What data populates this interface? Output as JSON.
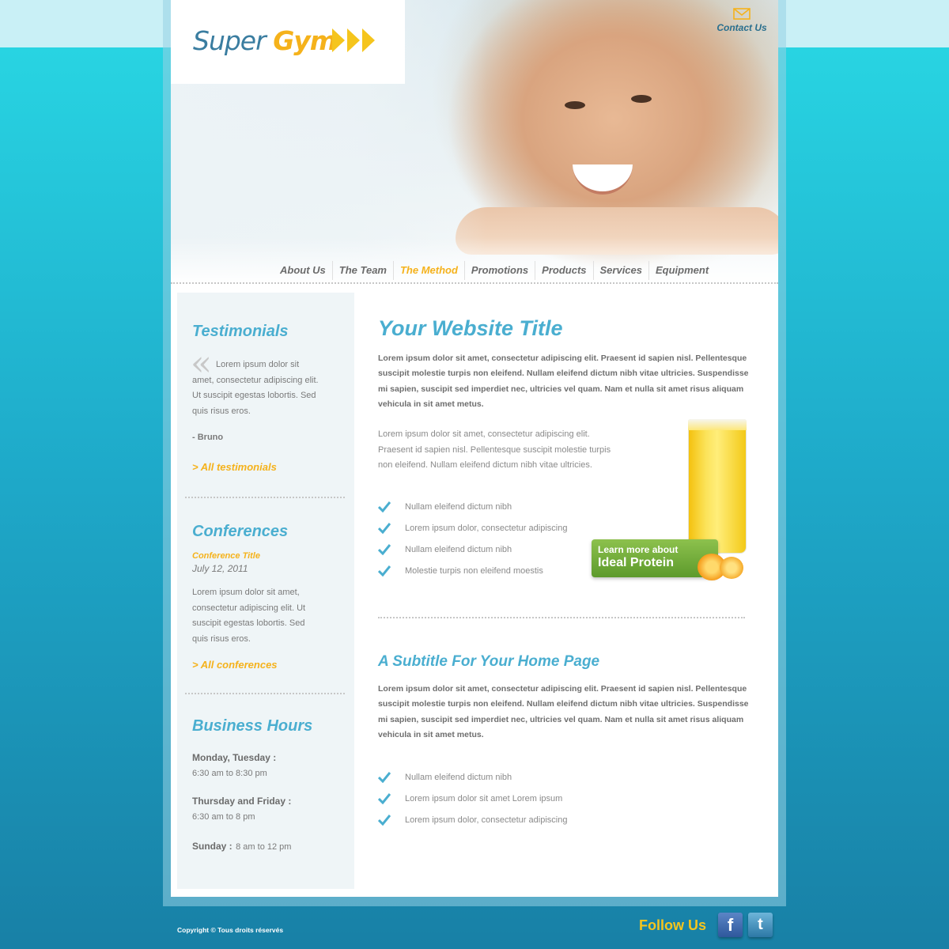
{
  "brand": {
    "word1": "Super",
    "word2": "Gym"
  },
  "header": {
    "contact_label": "Contact Us"
  },
  "nav": {
    "items": [
      "About Us",
      "The Team",
      "The Method",
      "Promotions",
      "Products",
      "Services",
      "Equipment"
    ],
    "active_index": 2
  },
  "sidebar": {
    "testimonials": {
      "title": "Testimonials",
      "quote": "Lorem ipsum dolor sit amet, consectetur adipiscing elit. Ut suscipit egestas lobortis. Sed quis risus eros.",
      "author": "- Bruno",
      "link": "> All testimonials"
    },
    "conferences": {
      "title": "Conferences",
      "item_title": "Conference Title",
      "item_date": "July 12, 2011",
      "text": "Lorem ipsum dolor sit amet, consectetur adipiscing elit. Ut suscipit egestas lobortis. Sed quis risus eros.",
      "link": "> All conferences"
    },
    "hours": {
      "title": "Business Hours",
      "rows": [
        {
          "day": "Monday, Tuesday :",
          "time": "6:30 am to 8:30 pm"
        },
        {
          "day": "Thursday and Friday :",
          "time": "6:30 am to 8 pm"
        },
        {
          "day": "Sunday :",
          "time": "8 am to 12 pm"
        }
      ]
    }
  },
  "main": {
    "title": "Your Website Title",
    "intro": "Lorem ipsum dolor sit amet, consectetur adipiscing elit. Praesent id sapien nisl. Pellentesque suscipit molestie turpis non eleifend. Nullam eleifend dictum nibh vitae ultricies. Suspendisse mi sapien, suscipit sed imperdiet nec, ultricies vel quam. Nam et nulla sit amet risus aliquam vehicula in sit amet metus.",
    "para": "Lorem ipsum dolor sit amet, consectetur adipiscing elit. Praesent id sapien nisl. Pellentesque suscipit molestie turpis non eleifend. Nullam eleifend dictum nibh vitae ultricies.",
    "checklist1": [
      "Nullam eleifend dictum nibh",
      "Lorem ipsum dolor, consectetur adipiscing",
      "Nullam eleifend dictum nibh",
      "Molestie turpis non eleifend moestis"
    ],
    "promo": {
      "line1": "Learn more about",
      "line2": "Ideal Protein"
    },
    "subtitle": "A Subtitle For Your Home Page",
    "intro2": "Lorem ipsum dolor sit amet, consectetur adipiscing elit. Praesent id sapien nisl. Pellentesque suscipit molestie turpis non eleifend. Nullam eleifend dictum nibh vitae ultricies. Suspendisse mi sapien, suscipit sed imperdiet nec, ultricies vel quam. Nam et nulla sit amet risus aliquam vehicula in sit amet metus.",
    "checklist2": [
      "Nullam eleifend dictum nibh",
      "Lorem ipsum dolor sit amet Lorem ipsum",
      "Lorem ipsum dolor, consectetur adipiscing"
    ]
  },
  "footer": {
    "copyright": "Copyright © Tous droits réservés",
    "follow_label": "Follow Us",
    "facebook_glyph": "f",
    "twitter_glyph": "t"
  },
  "colors": {
    "accent_blue": "#4aaed0",
    "accent_yellow": "#f5b21b",
    "background_teal": "#1ea9c9"
  },
  "icons": [
    "mail-icon",
    "logo-arrows-icon",
    "quote-icon",
    "check-icon",
    "facebook-icon",
    "twitter-icon"
  ]
}
